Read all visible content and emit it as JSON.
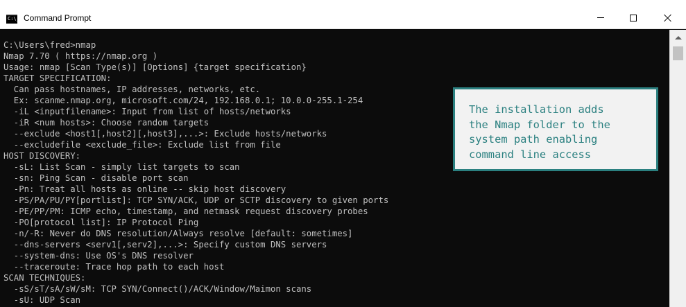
{
  "window": {
    "title": "Command Prompt",
    "icon": "cmd-icon",
    "icon_glyph": "C:\\_"
  },
  "controls": {
    "minimize": "minimize-icon",
    "maximize": "maximize-icon",
    "close": "close-icon"
  },
  "console": {
    "lines": [
      "C:\\Users\\fred>nmap",
      "Nmap 7.70 ( https://nmap.org )",
      "Usage: nmap [Scan Type(s)] [Options] {target specification}",
      "TARGET SPECIFICATION:",
      "  Can pass hostnames, IP addresses, networks, etc.",
      "  Ex: scanme.nmap.org, microsoft.com/24, 192.168.0.1; 10.0.0-255.1-254",
      "  -iL <inputfilename>: Input from list of hosts/networks",
      "  -iR <num hosts>: Choose random targets",
      "  --exclude <host1[,host2][,host3],...>: Exclude hosts/networks",
      "  --excludefile <exclude_file>: Exclude list from file",
      "HOST DISCOVERY:",
      "  -sL: List Scan - simply list targets to scan",
      "  -sn: Ping Scan - disable port scan",
      "  -Pn: Treat all hosts as online -- skip host discovery",
      "  -PS/PA/PU/PY[portlist]: TCP SYN/ACK, UDP or SCTP discovery to given ports",
      "  -PE/PP/PM: ICMP echo, timestamp, and netmask request discovery probes",
      "  -PO[protocol list]: IP Protocol Ping",
      "  -n/-R: Never do DNS resolution/Always resolve [default: sometimes]",
      "  --dns-servers <serv1[,serv2],...>: Specify custom DNS servers",
      "  --system-dns: Use OS's DNS resolver",
      "  --traceroute: Trace hop path to each host",
      "SCAN TECHNIQUES:",
      "  -sS/sT/sA/sW/sM: TCP SYN/Connect()/ACK/Window/Maimon scans",
      "  -sU: UDP Scan"
    ],
    "text_color": "#c0c0c0",
    "background": "#0c0c0c"
  },
  "callout": {
    "text": "The installation adds\nthe Nmap folder to the\nsystem path enabling\ncommand line access",
    "border_color": "#2b8080",
    "background": "#f2f2f2"
  }
}
